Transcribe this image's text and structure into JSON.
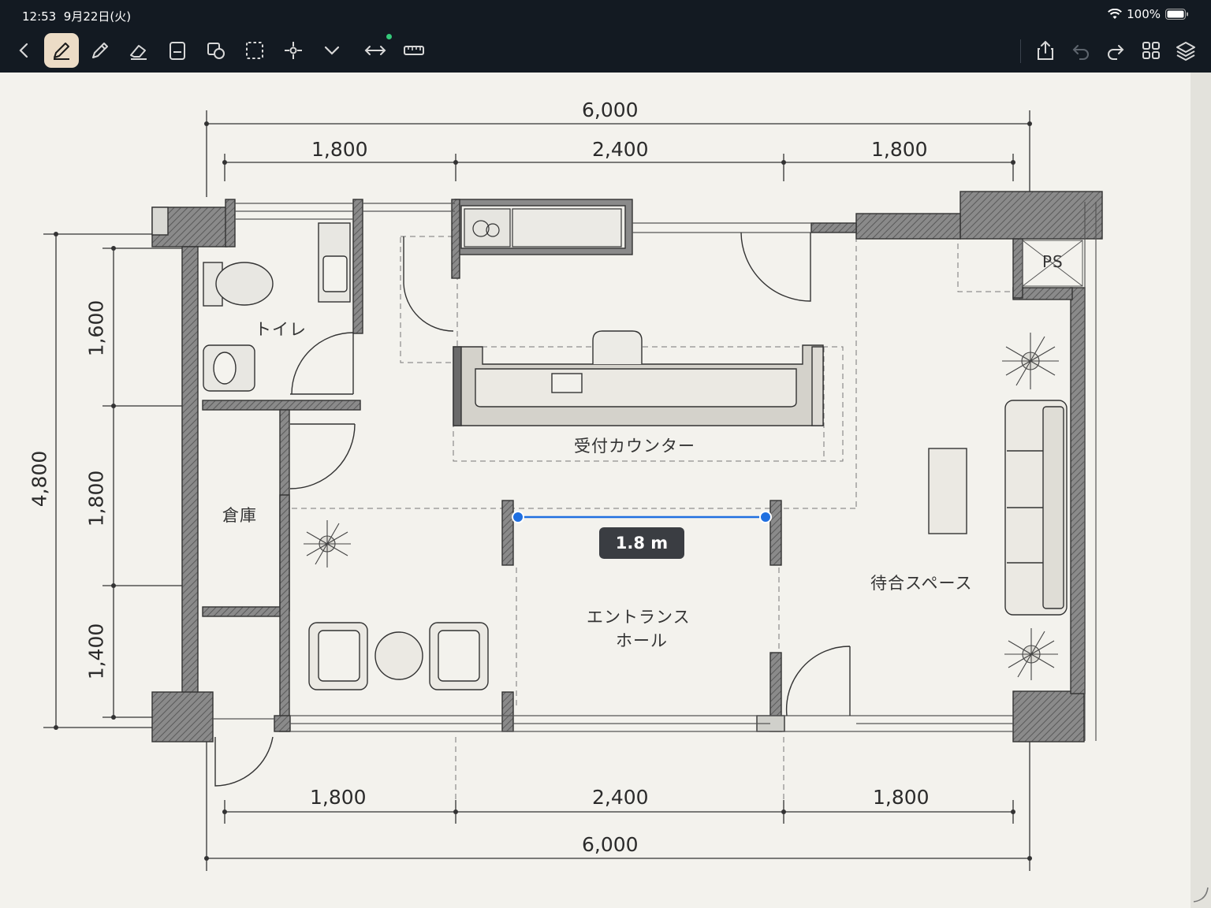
{
  "status": {
    "time": "12:53",
    "date": "9月22日(火)",
    "battery": "100%"
  },
  "toolbar": {
    "left": [
      "back-icon",
      "pen-icon",
      "pencil-icon",
      "eraser-icon",
      "page-icon",
      "shapes-icon",
      "lasso-icon",
      "crosshair-icon",
      "chevron-down-icon",
      "arrow-width-icon",
      "ruler-icon"
    ],
    "right": [
      "share-icon",
      "undo-icon",
      "redo-icon",
      "grid-icon",
      "layers-icon"
    ],
    "active": "pen-icon"
  },
  "plan": {
    "top_total": "6,000",
    "top_segments": [
      "1,800",
      "2,400",
      "1,800"
    ],
    "bottom_segments": [
      "1,800",
      "2,400",
      "1,800"
    ],
    "bottom_total": "6,000",
    "left_total": "4,800",
    "left_segments": [
      "1,600",
      "1,800",
      "1,400"
    ],
    "rooms": {
      "toilet": "トイレ",
      "storage": "倉庫",
      "reception": "受付カウンター",
      "entrance_line1": "エントランス",
      "entrance_line2": "ホール",
      "waiting": "待合スペース",
      "ps": "PS"
    },
    "measurement": "1.8 m"
  },
  "colors": {
    "toolbar_bg": "#131a22",
    "active_tool": "#ecdcc6",
    "measure_blue": "#1f6fe0",
    "wall": "#6a6a6a"
  }
}
